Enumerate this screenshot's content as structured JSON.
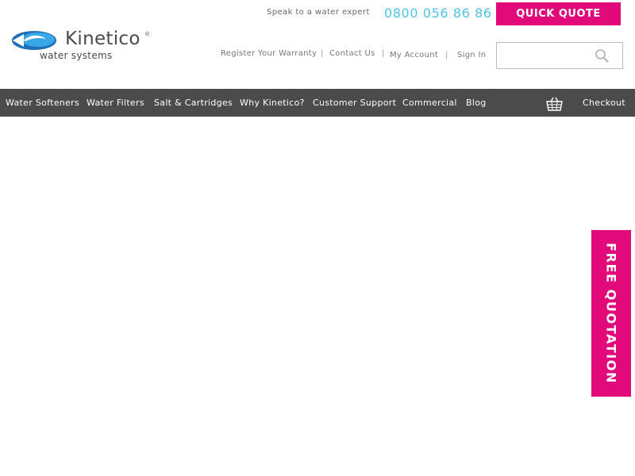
{
  "logo": {
    "brand": "Kinetico",
    "registered_mark": "®",
    "tagline": "water systems"
  },
  "contact": {
    "expert_label": "Speak to a water expert",
    "phone": "0800 056 86 86"
  },
  "quick_quote_label": "QUICK QUOTE",
  "utility_links": [
    "Register Your Warranty",
    "Contact Us",
    "My Account",
    "Sign In"
  ],
  "search": {
    "placeholder": "",
    "icon": "search-icon"
  },
  "nav": {
    "items": [
      "Water Softeners",
      "Water Filters",
      "Salt & Cartridges",
      "Why Kinetico?",
      "Customer Support",
      "Commercial",
      "Blog"
    ],
    "basket_icon": "basket-icon",
    "checkout_label": "Checkout"
  },
  "free_quotation_label": "FREE QUOTATION",
  "colors": {
    "accent_pink": "#e2097a",
    "phone_blue": "#4fc3e8",
    "nav_bg": "#4b4b4b",
    "logo_blue": "#1f6fb8"
  }
}
